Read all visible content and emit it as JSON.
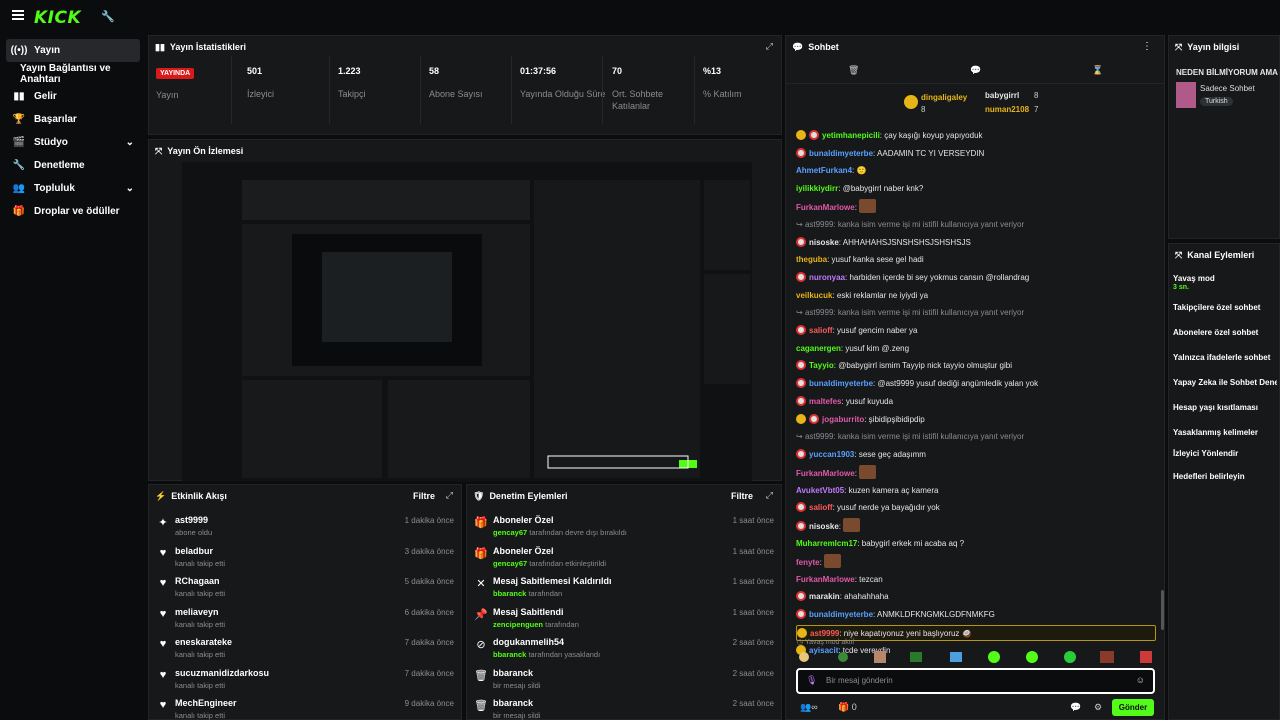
{
  "brand": "KICK",
  "sidebar": [
    {
      "label": "Yayın",
      "icon": "broadcast-icon",
      "active": true
    },
    {
      "label": "Yayın Bağlantısı ve Anahtarı"
    },
    {
      "label": "Gelir",
      "icon": "chart-icon"
    },
    {
      "label": "Başarılar",
      "icon": "trophy-icon"
    },
    {
      "label": "Stüdyo",
      "icon": "studio-icon",
      "chevron": true
    },
    {
      "label": "Denetleme",
      "icon": "wrench-icon"
    },
    {
      "label": "Topluluk",
      "icon": "community-icon",
      "chevron": true
    },
    {
      "label": "Droplar ve ödüller",
      "icon": "gift-icon"
    }
  ],
  "stats": {
    "title": "Yayın İstatistikleri",
    "live_badge": "YAYINDA",
    "live_label": "Yayın",
    "items": [
      {
        "value": "501",
        "label": "İzleyici"
      },
      {
        "value": "1.223",
        "label": "Takipçi"
      },
      {
        "value": "58",
        "label": "Abone Sayısı"
      },
      {
        "value": "01:37:56",
        "label": "Yayında Olduğu Süre"
      },
      {
        "value": "70",
        "label": "Ort. Sohbete Katılanlar"
      },
      {
        "value": "%13",
        "label": "% Katılım"
      }
    ]
  },
  "preview": {
    "title": "Yayın Ön İzlemesi"
  },
  "activity": {
    "title": "Etkinlik Akışı",
    "filter": "Filtre",
    "rows": [
      {
        "icon": "sparkle-icon",
        "name": "ast9999",
        "sub": "abone oldu",
        "time": "1 dakika önce"
      },
      {
        "icon": "heart-icon",
        "name": "beladbur",
        "sub": "kanalı takip etti",
        "time": "3 dakika önce"
      },
      {
        "icon": "heart-icon",
        "name": "RChagaan",
        "sub": "kanalı takip etti",
        "time": "5 dakika önce"
      },
      {
        "icon": "heart-icon",
        "name": "meliaveyn",
        "sub": "kanalı takip etti",
        "time": "6 dakika önce"
      },
      {
        "icon": "heart-icon",
        "name": "eneskarateke",
        "sub": "kanalı takip etti",
        "time": "7 dakika önce"
      },
      {
        "icon": "heart-icon",
        "name": "sucuzmanidizdarkosu",
        "sub": "kanalı takip etti",
        "time": "7 dakika önce"
      },
      {
        "icon": "heart-icon",
        "name": "MechEngineer",
        "sub": "kanalı takip etti",
        "time": "9 dakika önce"
      }
    ]
  },
  "moderation": {
    "title": "Denetim Eylemleri",
    "filter": "Filtre",
    "rows": [
      {
        "icon": "gift-icon",
        "title": "Aboneler Özel",
        "user": "gencay67",
        "sub": "tarafından devre dışı bırakıldı",
        "time": "1 saat önce"
      },
      {
        "icon": "gift-icon",
        "title": "Aboneler Özel",
        "user": "gencay67",
        "sub": "tarafından etkinleştirildi",
        "time": "1 saat önce"
      },
      {
        "icon": "unpin-icon",
        "title": "Mesaj Sabitlemesi Kaldırıldı",
        "user": "bbaranck",
        "sub": "tarafından",
        "time": "1 saat önce"
      },
      {
        "icon": "pin-icon",
        "title": "Mesaj Sabitlendi",
        "user": "zencipenguen",
        "sub": "tarafından",
        "time": "1 saat önce"
      },
      {
        "icon": "ban-icon",
        "title": "dogukanmelih54",
        "user": "bbaranck",
        "sub": "tarafından yasaklandı",
        "time": "2 saat önce"
      },
      {
        "icon": "trash-icon",
        "title": "bbaranck",
        "user": "",
        "sub": "bir mesajı sildi",
        "time": "2 saat önce"
      },
      {
        "icon": "trash-icon",
        "title": "bbaranck",
        "user": "",
        "sub": "bir mesajı sildi",
        "time": "2 saat önce"
      }
    ]
  },
  "chat": {
    "title": "Sohbet",
    "gifters": {
      "top": {
        "name": "dingaligaley",
        "count": "8"
      },
      "second": {
        "name": "babygirrl",
        "count": "8"
      },
      "third": {
        "name": "numan2108",
        "count": "7"
      }
    },
    "messages": [
      {
        "u": "yetimhanepicili",
        "c": "#53fc18",
        "t": ": çay kaşığı koyup yapıyoduk",
        "b": "gr"
      },
      {
        "u": "bunaldimyeterbe",
        "c": "#5aa0ff",
        "t": ": AADAMIN TC YI VERSEYDIN",
        "b": "r"
      },
      {
        "u": "AhmetFurkan4",
        "c": "#5aa0ff",
        "t": ": 🙂",
        "b": ""
      },
      {
        "u": "iyilikkiydirr",
        "c": "#53fc18",
        "t": ": @babygirrl naber knk?",
        "b": ""
      },
      {
        "u": "FurkanMarlowe",
        "c": "#e05aa8",
        "t": ":",
        "b": "",
        "emote": true
      },
      {
        "reply": "ast9999: kanka isim verme işi mi istifil kullanıcıya yanıt veriyor"
      },
      {
        "u": "nisoske",
        "c": "#e6e6e6",
        "t": ": AHHAHAHSJSNSHSHSJSHSHSJS",
        "b": "r"
      },
      {
        "u": "theguba",
        "c": "#e8b516",
        "t": ": yusuf kanka sese gel hadi",
        "b": ""
      },
      {
        "u": "nuronyaa",
        "c": "#c07aff",
        "t": ": harbiden içerde bi sey yokmus cansın @rollandrag",
        "b": "r"
      },
      {
        "u": "veilkucuk",
        "c": "#e8b516",
        "t": ": eski reklamlar ne iyiydi ya",
        "b": ""
      },
      {
        "reply": "ast9999: kanka isim verme işi mi istifil kullanıcıya yanıt veriyor"
      },
      {
        "u": "salioff",
        "c": "#ff5a5a",
        "t": ": yusuf gencim naber ya",
        "b": "r"
      },
      {
        "u": "caganergen",
        "c": "#53fc18",
        "t": ": yusuf kim @.zeng",
        "b": ""
      },
      {
        "u": "Tayyio",
        "c": "#53fc18",
        "t": ": @babygirrl ismim Tayyip nick tayyio olmuştur gibi",
        "b": "r"
      },
      {
        "u": "bunaldimyeterbe",
        "c": "#5aa0ff",
        "t": ": @ast9999 yusuf dediği angümledik yalan yok",
        "b": "r"
      },
      {
        "u": "maltefes",
        "c": "#e05aa8",
        "t": ": yusuf kuyuda",
        "b": "r"
      },
      {
        "u": "jogaburrito",
        "c": "#e05aa8",
        "t": ": şibidipşibidipdip",
        "b": "gr"
      },
      {
        "reply": "ast9999: kanka isim verme işi mi istifil kullanıcıya yanıt veriyor"
      },
      {
        "u": "yuccan1903",
        "c": "#5aa0ff",
        "t": ": sese geç adaşımm",
        "b": "r"
      },
      {
        "u": "FurkanMarlowe",
        "c": "#e05aa8",
        "t": ":",
        "b": "",
        "emote": true
      },
      {
        "u": "AvuketVbt05",
        "c": "#c07aff",
        "t": ": kuzen kamera aç kamera",
        "b": ""
      },
      {
        "u": "salioff",
        "c": "#ff5a5a",
        "t": ": yusuf nerde ya bayağıdır yok",
        "b": "r"
      },
      {
        "u": "nisoske",
        "c": "#e6e6e6",
        "t": ":",
        "b": "r",
        "emote": true
      },
      {
        "u": "Muharremlcm17",
        "c": "#53fc18",
        "t": ": babygirl erkek mi acaba aq ?",
        "b": ""
      },
      {
        "u": "fenyte",
        "c": "#e05aa8",
        "t": ":",
        "b": "",
        "emote": true
      },
      {
        "u": "FurkanMarlowe",
        "c": "#e05aa8",
        "t": ": tezcan",
        "b": ""
      },
      {
        "u": "marakin",
        "c": "#e6e6e6",
        "t": ": ahahahhaha",
        "b": "r"
      },
      {
        "u": "bunaldimyeterbe",
        "c": "#5aa0ff",
        "t": ": ANMKLDFKNGMKLGDFNMKFG",
        "b": "r"
      },
      {
        "u": "ast9999",
        "c": "#ff5a5a",
        "t": ": niye kapatıyonuz yeni başlıyoruz 🥥",
        "b": "gg",
        "highlight": true
      },
      {
        "u": "ayisacit",
        "c": "#5aa0ff",
        "t": ": tcde vereydin",
        "b": "g"
      }
    ],
    "slow_mode": "Yavaş mod aktif",
    "input_placeholder": "Bir mesaj gönderin",
    "viewer_icon_count": "∞",
    "gift_count": "0",
    "send": "Gönder"
  },
  "stream_info": {
    "title": "Yayın bilgisi",
    "stream_title": "NEDEN BİLMİYORUM AMA",
    "category": "Sadece Sohbet",
    "tag": "Turkish"
  },
  "channel_actions": {
    "title": "Kanal Eylemleri",
    "slow": "Yavaş mod",
    "slow_val": "3 sn.",
    "items": [
      "Takipçilere özel sohbet",
      "Abonelere özel sohbet",
      "Yalnızca ifadelerle sohbet",
      "Yapay Zeka ile Sohbet Denetimi",
      "Hesap yaşı kısıtlaması",
      "Yasaklanmış kelimeler",
      "İzleyici Yönlendir",
      "Hedefleri belirleyin"
    ]
  }
}
